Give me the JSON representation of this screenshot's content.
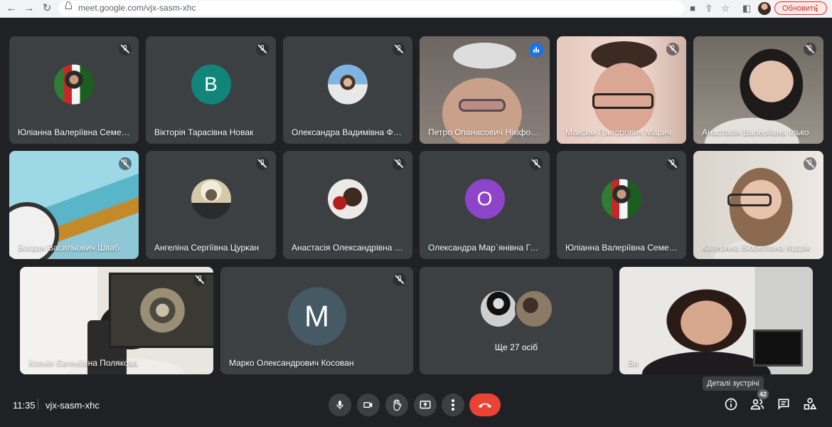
{
  "browser": {
    "url": "meet.google.com/vjx-sasm-xhc",
    "update_label": "Обновить"
  },
  "tiles": [
    {
      "name": "Юліанна Валеріївна Семенюк",
      "muted": true
    },
    {
      "name": "Вікторія Тарасівна Новак",
      "muted": true,
      "avatar_letter": "В",
      "avatar_color": "#12857a"
    },
    {
      "name": "Олександра Вадимівна Фри...",
      "muted": true
    },
    {
      "name": "Петро Опанасович Нікіфоров",
      "speaking": true
    },
    {
      "name": "Максим Григорович Марич",
      "muted": true
    },
    {
      "name": "Анастасія Валеріївна Ілько",
      "muted": true
    },
    {
      "name": "Богдан Васильович Шваб",
      "muted": true
    },
    {
      "name": "Ангеліна Сергіївна Цуркан",
      "muted": true
    },
    {
      "name": "Анастасія Олександрівна Н...",
      "muted": true
    },
    {
      "name": "Олександра Мар`янівна Галі...",
      "muted": true,
      "avatar_letter": "О",
      "avatar_color": "#8e44c9"
    },
    {
      "name": "Юліанна Валеріївна Семенюк",
      "muted": true
    },
    {
      "name": "Катерина Віорелівна Кудрік",
      "muted": true
    },
    {
      "name": "Ксенія Євгеніївна Полякова",
      "muted": true
    },
    {
      "name": "Марко Олександрович Косован",
      "muted": true,
      "avatar_letter": "М",
      "avatar_color": "#455a64"
    },
    {
      "name": "Ще 27 осіб",
      "muted": false
    },
    {
      "name": "Ви",
      "muted": false
    }
  ],
  "bottom_bar": {
    "time": "11:35",
    "meeting_code": "vjx-sasm-xhc",
    "tooltip": "Деталі зустрічі",
    "participants_count": "42",
    "end_call_color": "#ea4335"
  },
  "icons": [
    "back-icon",
    "forward-icon",
    "reload-icon",
    "lock-icon",
    "camera-blocked-icon",
    "share-icon",
    "star-icon",
    "sidepanel-icon",
    "profile-avatar",
    "microphone-icon",
    "camera-icon",
    "raise-hand-icon",
    "present-icon",
    "more-options-icon",
    "end-call-icon",
    "info-icon",
    "people-icon",
    "chat-icon",
    "activities-icon",
    "mic-off-icon",
    "speaking-icon"
  ]
}
